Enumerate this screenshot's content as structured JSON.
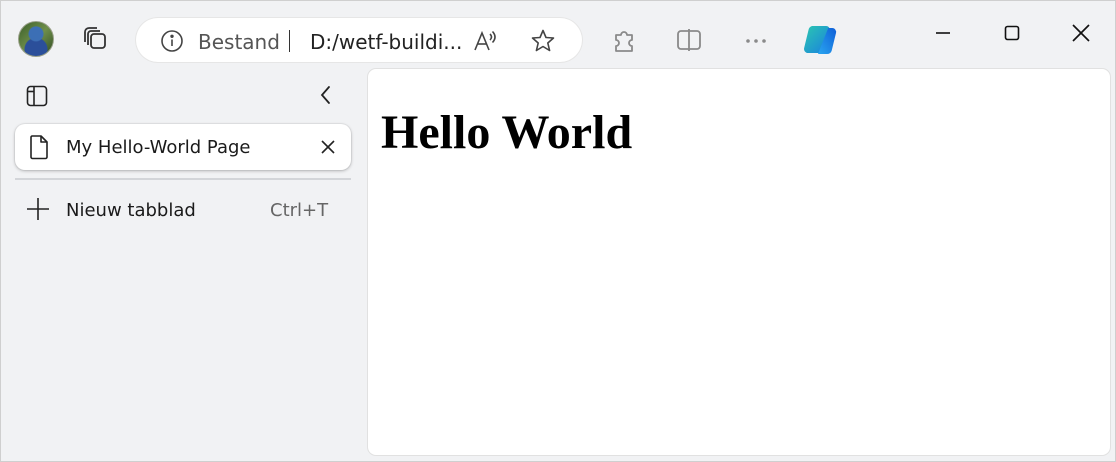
{
  "browser": {
    "address_bar": {
      "security_label": "Bestand",
      "url": "D:/wetf-buildi..."
    }
  },
  "sidebar": {
    "tabs": [
      {
        "title": "My Hello-World Page"
      }
    ],
    "new_tab": {
      "label": "Nieuw tabblad",
      "shortcut": "Ctrl+T"
    }
  },
  "page": {
    "heading": "Hello World"
  },
  "icons": {
    "profile": "avatar",
    "workspaces": "tab-actions-icon",
    "info": "info-icon",
    "read_aloud": "read-aloud-icon",
    "favorite": "star-icon",
    "extensions": "puzzle-icon",
    "split_screen": "split-screen-icon",
    "more": "more-icon",
    "copilot": "copilot-icon",
    "minimize": "minimize-icon",
    "maximize": "maximize-icon",
    "close": "close-icon"
  },
  "colors": {
    "chrome_bg": "#f1f2f4",
    "copilot_blue": "#1a7fe0",
    "copilot_teal": "#2bc7b0"
  }
}
